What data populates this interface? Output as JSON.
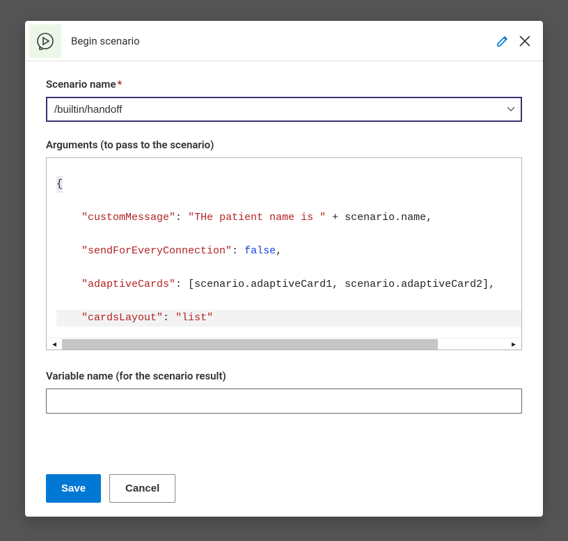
{
  "header": {
    "title": "Begin scenario"
  },
  "labels": {
    "scenario_name": "Scenario name",
    "required_marker": "*",
    "arguments": "Arguments (to pass to the scenario)",
    "variable_name": "Variable name (for the scenario result)"
  },
  "fields": {
    "scenario_name_value": "/builtin/handoff",
    "variable_name_value": ""
  },
  "editor": {
    "line1_open": "{",
    "line2_key": "\"customMessage\"",
    "line2_colon": ": ",
    "line2_str": "\"THe patient name is \"",
    "line2_plus": " + scenario.name,",
    "line3_key": "\"sendForEveryConnection\"",
    "line3_colon": ": ",
    "line3_bool": "false",
    "line3_comma": ",",
    "line4_key": "\"adaptiveCards\"",
    "line4_colon": ": ",
    "line4_arr": "[scenario.adaptiveCard1, scenario.adaptiveCard2],",
    "line5_key": "\"cardsLayout\"",
    "line5_colon": ": ",
    "line5_str": "\"list\"",
    "line6_close": "}"
  },
  "actions": {
    "save": "Save",
    "cancel": "Cancel"
  }
}
